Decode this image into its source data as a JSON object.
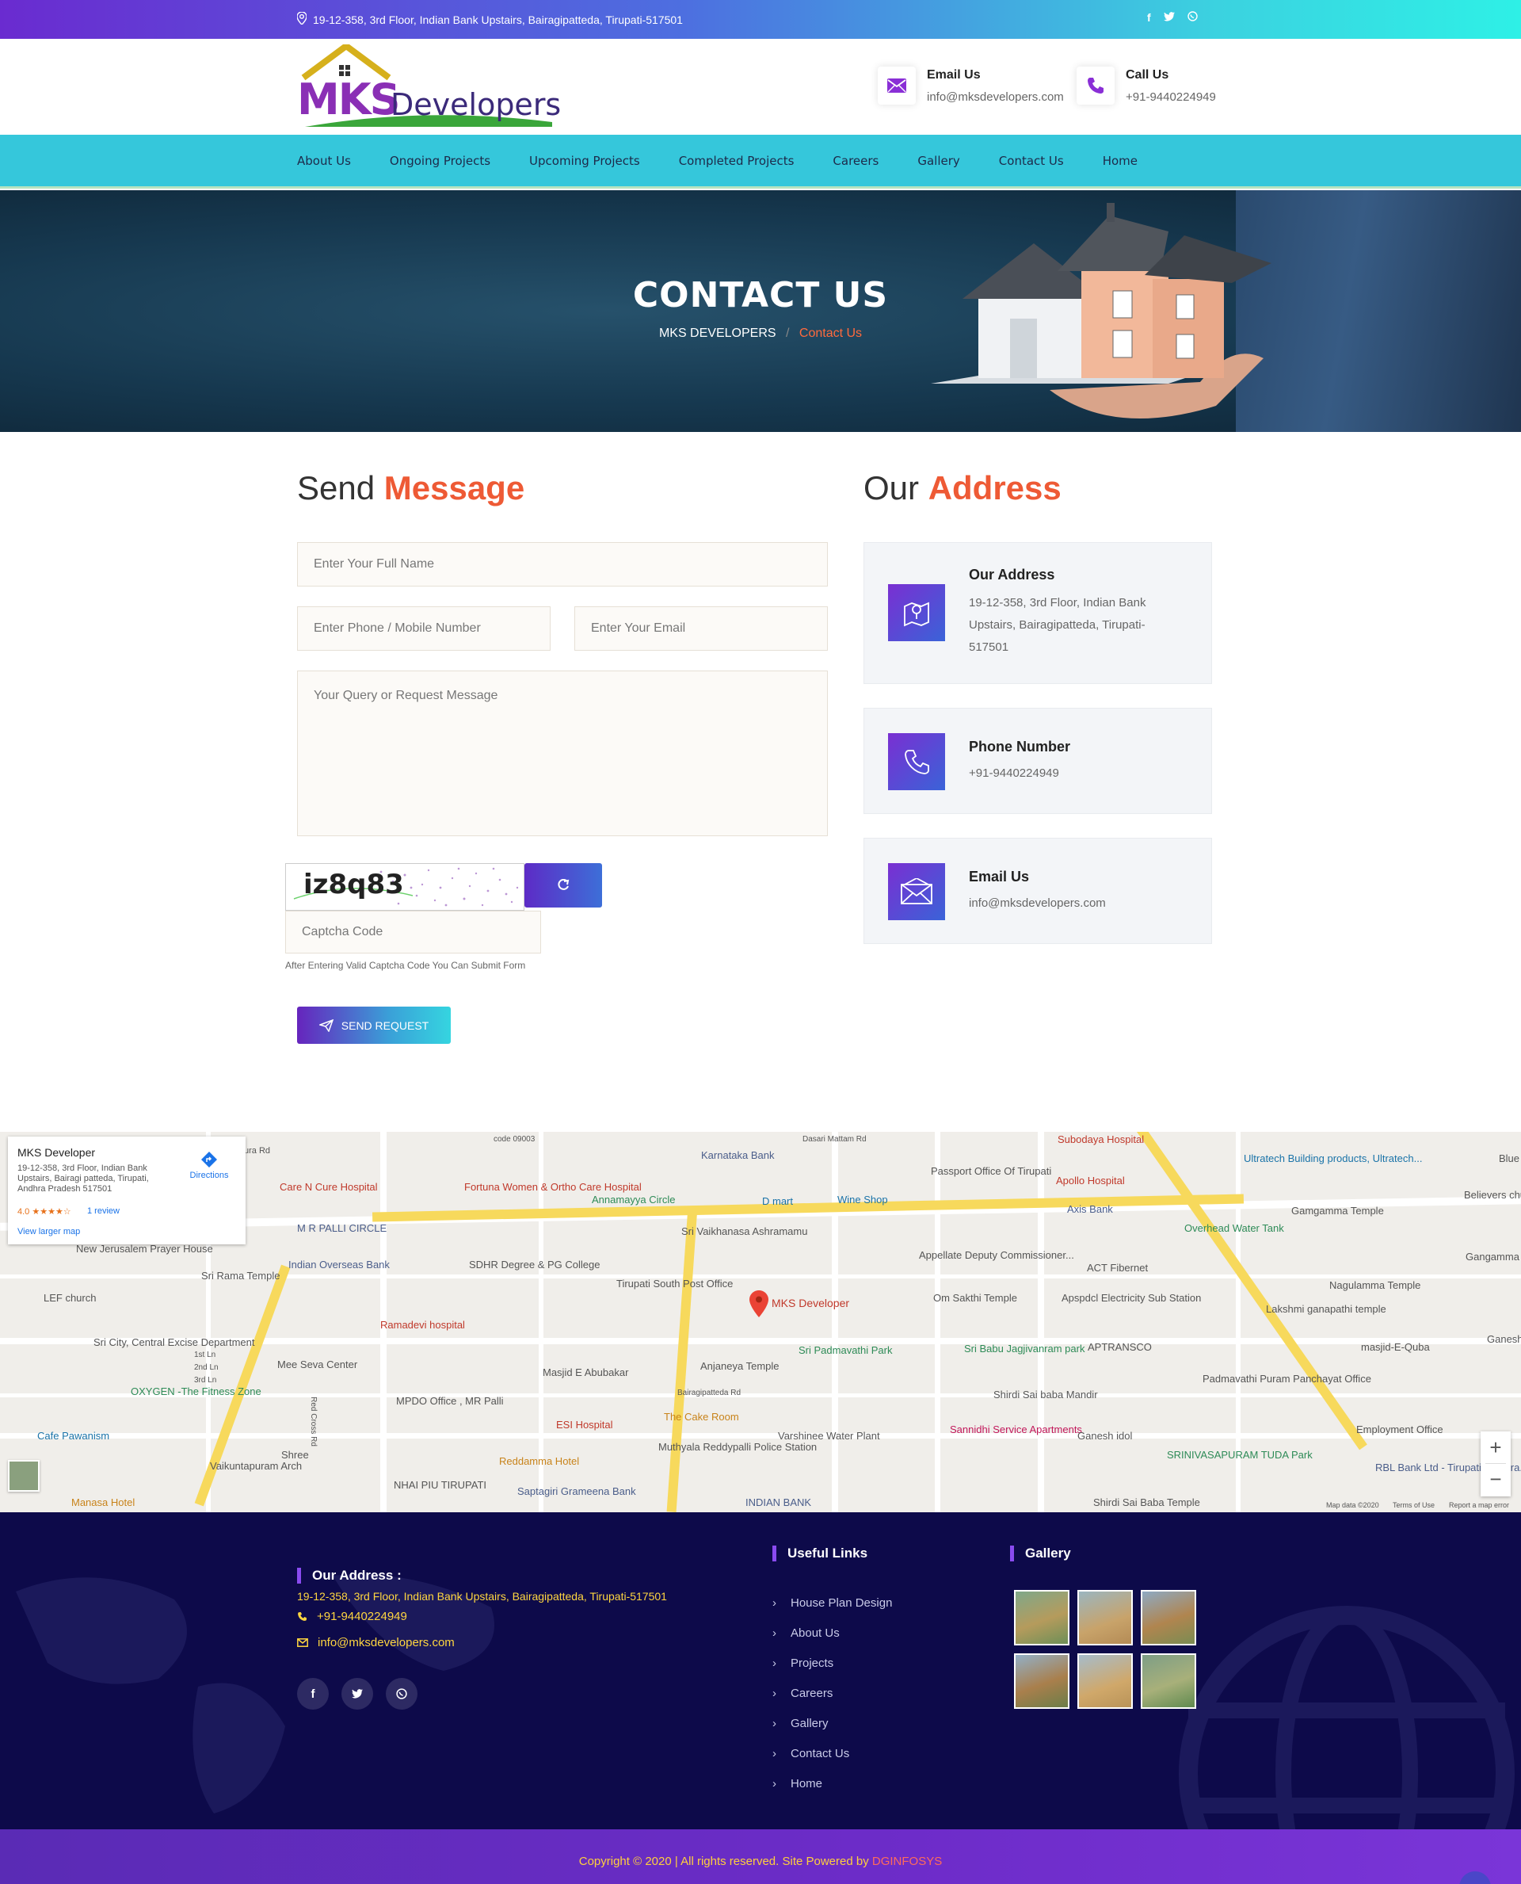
{
  "topbar": {
    "address": "19-12-358, 3rd Floor, Indian Bank Upstairs, Bairagipatteda, Tirupati-517501",
    "social_icons": [
      "facebook-icon",
      "twitter-icon",
      "whatsapp-icon"
    ]
  },
  "header": {
    "logo_text_a": "MKS",
    "logo_text_b": "Developers",
    "email_label": "Email Us",
    "email_value": "info@mksdevelopers.com",
    "call_label": "Call Us",
    "call_value": "+91-9440224949"
  },
  "nav": {
    "items": [
      "About Us",
      "Ongoing Projects",
      "Upcoming Projects",
      "Completed Projects",
      "Careers",
      "Gallery",
      "Contact Us",
      "Home"
    ]
  },
  "banner": {
    "title": "CONTACT US",
    "crumb_home": "MKS DEVELOPERS",
    "crumb_sep": "/",
    "crumb_current": "Contact Us"
  },
  "form": {
    "heading_a": "Send",
    "heading_b": "Message",
    "name_placeholder": "Enter Your Full Name",
    "phone_placeholder": "Enter Phone / Mobile Number",
    "email_placeholder": "Enter Your Email",
    "message_placeholder": "Your Query or Request Message",
    "captcha_text": "iz8q83",
    "captcha_placeholder": "Captcha Code",
    "captcha_hint": "After Entering Valid Captcha Code You Can Submit Form",
    "submit_label": "SEND REQUEST"
  },
  "address_section": {
    "heading_a": "Our",
    "heading_b": "Address",
    "cards": [
      {
        "title": "Our Address",
        "value": "19-12-358, 3rd Floor, Indian Bank Upstairs, Bairagipatteda, Tirupati-517501",
        "icon": "map-icon"
      },
      {
        "title": "Phone Number",
        "value": "+91-9440224949",
        "icon": "phone-icon"
      },
      {
        "title": "Email Us",
        "value": "info@mksdevelopers.com",
        "icon": "envelope-icon"
      }
    ]
  },
  "map": {
    "card_title": "MKS Developer",
    "card_address": "19-12-358, 3rd Floor, Indian Bank Upstairs, Bairagi patteda, Tirupati, Andhra Pradesh 517501",
    "card_rating": "4.0",
    "card_stars": "★★★★☆",
    "card_reviews": "1 review",
    "card_directions": "Directions",
    "card_larger_map": "View larger map",
    "marker_label": "MKS Developer",
    "zoom_in": "+",
    "zoom_out": "−",
    "attribution": "Map data ©2020",
    "terms": "Terms of Use",
    "report": "Report a map error",
    "places": [
      {
        "text": "Karnataka Bank",
        "color": "#4a5d8a"
      },
      {
        "text": "Care N Cure Hospital",
        "color": "#c0392b"
      },
      {
        "text": "Fortuna Women & Ortho Care Hospital",
        "color": "#c0392b"
      },
      {
        "text": "Annamayya Circle",
        "color": "#2e8b57"
      },
      {
        "text": "D mart",
        "color": "#1a73a8"
      },
      {
        "text": "Wine Shop",
        "color": "#1a73a8"
      },
      {
        "text": "Passport Office Of Tirupati",
        "color": "#555"
      },
      {
        "text": "Subodaya Hospital",
        "color": "#c0392b"
      },
      {
        "text": "Apollo Hospital",
        "color": "#c0392b"
      },
      {
        "text": "Axis Bank",
        "color": "#4a5d8a"
      },
      {
        "text": "Ultratech Building products, Ultratech...",
        "color": "#1a73a8"
      },
      {
        "text": "Gamgamma Temple",
        "color": "#555"
      },
      {
        "text": "M R PALLI CIRCLE",
        "color": "#4a5d8a"
      },
      {
        "text": "Sri Vaikhanasa Ashramamu",
        "color": "#555"
      },
      {
        "text": "New Jerusalem Prayer House",
        "color": "#555"
      },
      {
        "text": "Sri Rama Temple",
        "color": "#555"
      },
      {
        "text": "Indian Overseas Bank",
        "color": "#4a5d8a"
      },
      {
        "text": "SDHR Degree & PG College",
        "color": "#555"
      },
      {
        "text": "Tirupati South Post Office",
        "color": "#555"
      },
      {
        "text": "Appellate Deputy Commissioner...",
        "color": "#555"
      },
      {
        "text": "ACT Fibernet",
        "color": "#555"
      },
      {
        "text": "LEF church",
        "color": "#555"
      },
      {
        "text": "Om Sakthi Temple",
        "color": "#555"
      },
      {
        "text": "Apspdcl Electricity Sub Station",
        "color": "#555"
      },
      {
        "text": "Ramadevi hospital",
        "color": "#c0392b"
      },
      {
        "text": "Sri City, Central Excise Department",
        "color": "#555"
      },
      {
        "text": "Sri Padmavathi Park",
        "color": "#2e8b57"
      },
      {
        "text": "Anjaneya Temple",
        "color": "#555"
      },
      {
        "text": "Sri Babu Jagjivanram park",
        "color": "#2e8b57"
      },
      {
        "text": "APTRANSCO",
        "color": "#555"
      },
      {
        "text": "Mee Seva Center",
        "color": "#555"
      },
      {
        "text": "Masjid E Abubakar",
        "color": "#555"
      },
      {
        "text": "Shirdi Sai baba Mandir",
        "color": "#555"
      },
      {
        "text": "Padmavathi Puram Panchayat Office",
        "color": "#555"
      },
      {
        "text": "OXYGEN -The Fitness Zone",
        "color": "#2e8b57"
      },
      {
        "text": "MPDO Office , MR Palli",
        "color": "#555"
      },
      {
        "text": "ESI Hospital",
        "color": "#c0392b"
      },
      {
        "text": "The Cake Room",
        "color": "#c8831a"
      },
      {
        "text": "Varshinee Water Plant",
        "color": "#555"
      },
      {
        "text": "Sannidhi Service Apartments",
        "color": "#c2185b"
      },
      {
        "text": "Ganesh idol",
        "color": "#555"
      },
      {
        "text": "Cafe Pawanism",
        "color": "#1a73a8"
      },
      {
        "text": "Vaikuntapuram Arch",
        "color": "#555"
      },
      {
        "text": "Reddamma Hotel",
        "color": "#c8831a"
      },
      {
        "text": "Muthyala Reddypalli Police Station",
        "color": "#555"
      },
      {
        "text": "SRINIVASAPURAM TUDA Park",
        "color": "#2e8b57"
      },
      {
        "text": "Employment Office",
        "color": "#555"
      },
      {
        "text": "RBL Bank Ltd - Tirupati, Andhra...",
        "color": "#4a5d8a"
      },
      {
        "text": "Manasa Hotel",
        "color": "#c8831a"
      },
      {
        "text": "NHAI PIU TIRUPATI",
        "color": "#555"
      },
      {
        "text": "Saptagiri Grameena Bank",
        "color": "#4a5d8a"
      },
      {
        "text": "INDIAN BANK",
        "color": "#4a5d8a"
      },
      {
        "text": "Shirdi Sai Baba Temple",
        "color": "#555"
      },
      {
        "text": "Nagulamma Temple",
        "color": "#555"
      },
      {
        "text": "Gangamma Temp",
        "color": "#555"
      },
      {
        "text": "Lakshmi ganapathi temple",
        "color": "#555"
      },
      {
        "text": "masjid-E-Quba",
        "color": "#555"
      },
      {
        "text": "Believers chu",
        "color": "#555"
      },
      {
        "text": "Blue",
        "color": "#555"
      },
      {
        "text": "Ganesh t",
        "color": "#555"
      },
      {
        "text": "Overhead Water Tank",
        "color": "#2e8b57"
      },
      {
        "text": "Shree",
        "color": "#555"
      }
    ],
    "roads": [
      {
        "text": "code 09003"
      },
      {
        "text": "Dasari Mattam Rd"
      },
      {
        "text": "Bairagipatteda Rd"
      },
      {
        "text": "Red Cross Rd"
      },
      {
        "text": "1st Ln"
      },
      {
        "text": "2nd Ln"
      },
      {
        "text": "3rd Ln"
      },
      {
        "text": "ura Rd"
      }
    ]
  },
  "footer": {
    "address_heading": "Our Address :",
    "address": "19-12-358, 3rd Floor, Indian Bank Upstairs, Bairagipatteda, Tirupati-517501",
    "phone": "+91-9440224949",
    "email": "info@mksdevelopers.com",
    "links_heading": "Useful Links",
    "links": [
      "House Plan Design",
      "About Us",
      "Projects",
      "Careers",
      "Gallery",
      "Contact Us",
      "Home"
    ],
    "gallery_heading": "Gallery",
    "copyright": "Copyright © 2020 | All rights reserved. Site Powered by",
    "powered_by": "DGINFOSYS"
  },
  "colors": {
    "accent": "#ee5a35",
    "nav_bg": "#35c7db",
    "footer_bg": "#0d0a4a",
    "footer_yellow": "#ffd640"
  }
}
